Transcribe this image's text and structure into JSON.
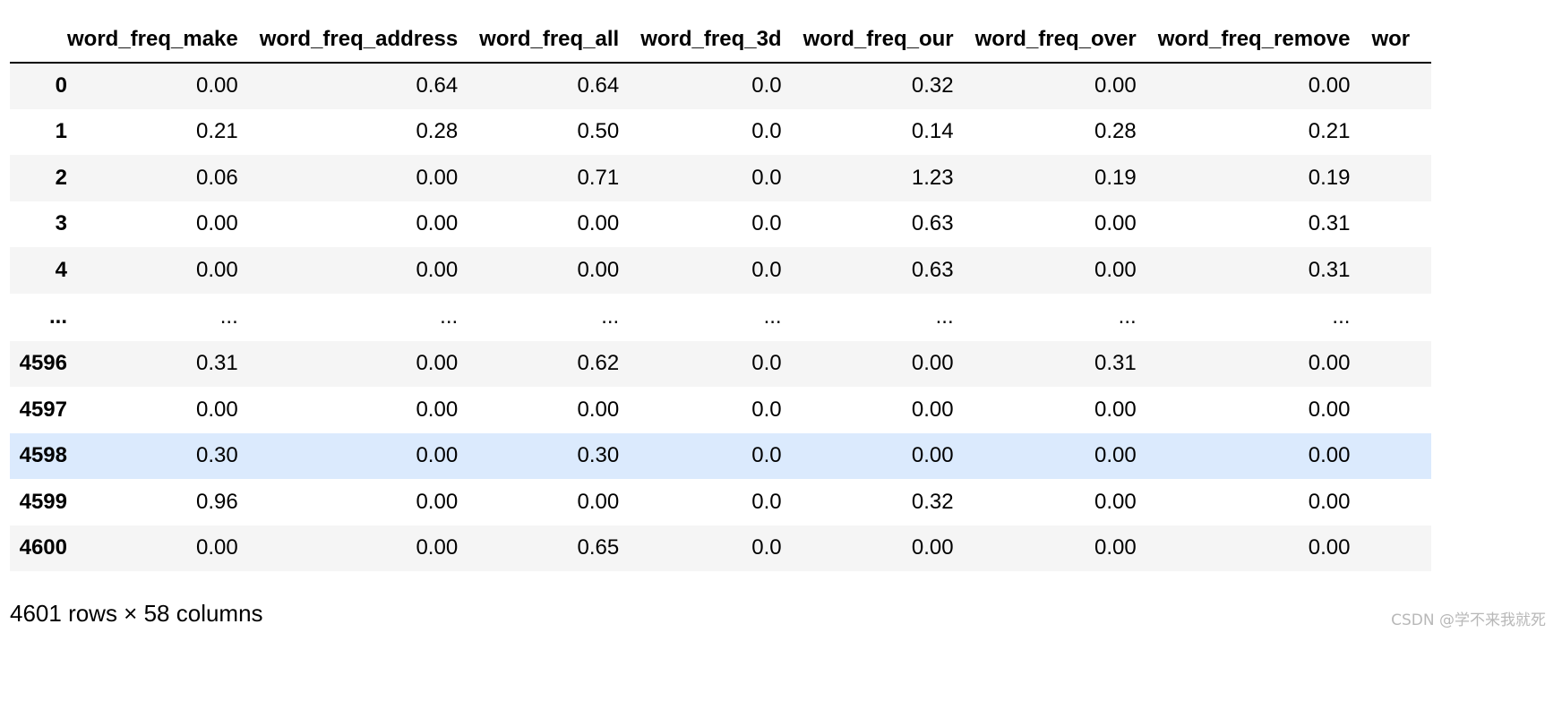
{
  "table": {
    "columns": [
      "",
      "word_freq_make",
      "word_freq_address",
      "word_freq_all",
      "word_freq_3d",
      "word_freq_our",
      "word_freq_over",
      "word_freq_remove",
      "wor"
    ],
    "rows": [
      {
        "index": "0",
        "cells": [
          "0.00",
          "0.64",
          "0.64",
          "0.0",
          "0.32",
          "0.00",
          "0.00"
        ]
      },
      {
        "index": "1",
        "cells": [
          "0.21",
          "0.28",
          "0.50",
          "0.0",
          "0.14",
          "0.28",
          "0.21"
        ]
      },
      {
        "index": "2",
        "cells": [
          "0.06",
          "0.00",
          "0.71",
          "0.0",
          "1.23",
          "0.19",
          "0.19"
        ]
      },
      {
        "index": "3",
        "cells": [
          "0.00",
          "0.00",
          "0.00",
          "0.0",
          "0.63",
          "0.00",
          "0.31"
        ]
      },
      {
        "index": "4",
        "cells": [
          "0.00",
          "0.00",
          "0.00",
          "0.0",
          "0.63",
          "0.00",
          "0.31"
        ]
      },
      {
        "index": "...",
        "cells": [
          "...",
          "...",
          "...",
          "...",
          "...",
          "...",
          "..."
        ]
      },
      {
        "index": "4596",
        "cells": [
          "0.31",
          "0.00",
          "0.62",
          "0.0",
          "0.00",
          "0.31",
          "0.00"
        ]
      },
      {
        "index": "4597",
        "cells": [
          "0.00",
          "0.00",
          "0.00",
          "0.0",
          "0.00",
          "0.00",
          "0.00"
        ]
      },
      {
        "index": "4598",
        "cells": [
          "0.30",
          "0.00",
          "0.30",
          "0.0",
          "0.00",
          "0.00",
          "0.00"
        ]
      },
      {
        "index": "4599",
        "cells": [
          "0.96",
          "0.00",
          "0.00",
          "0.0",
          "0.32",
          "0.00",
          "0.00"
        ]
      },
      {
        "index": "4600",
        "cells": [
          "0.00",
          "0.00",
          "0.65",
          "0.0",
          "0.00",
          "0.00",
          "0.00"
        ]
      }
    ],
    "highlighted_row": "4598"
  },
  "summary": "4601 rows × 58 columns",
  "watermark": "CSDN @学不来我就死",
  "colors": {
    "stripe": "#f5f5f5",
    "hover_highlight": "#dbeafd",
    "watermark": "#b8b8b8"
  }
}
